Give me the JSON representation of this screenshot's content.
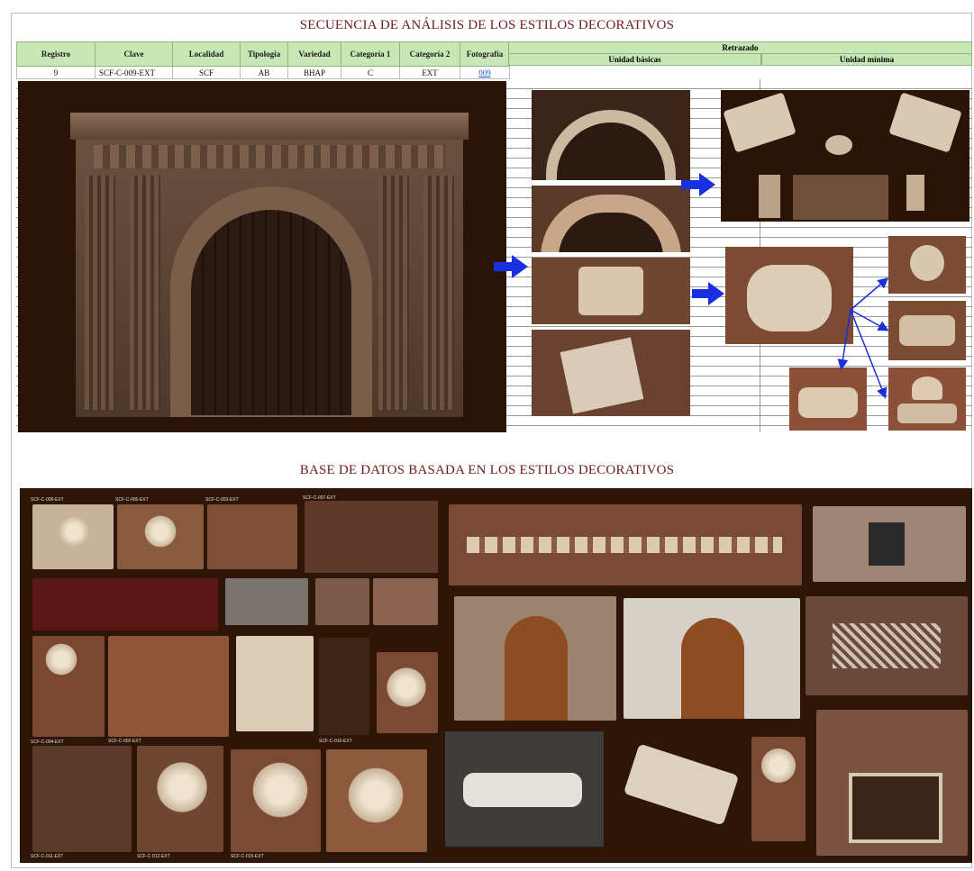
{
  "title_top": "SECUENCIA DE ANÁLISIS DE LOS ESTILOS DECORATIVOS",
  "title_bottom": "BASE DE DATOS BASADA EN LOS ESTILOS DECORATIVOS",
  "table": {
    "headers": [
      "Registro",
      "Clave",
      "Localidad",
      "Tipología",
      "Variedad",
      "Categoría 1",
      "Categoría 2",
      "Fotografía"
    ],
    "row": [
      "9",
      "SCF-C-009-EXT",
      "SCF",
      "AB",
      "BHAP",
      "C",
      "EXT",
      "009"
    ]
  },
  "retrazado": {
    "title": "Retrazado",
    "col1": "Unidad básicas",
    "col2": "Unidad mínima"
  },
  "colors": {
    "title": "#6b1d1d",
    "header_green": "#c7e8b6",
    "arrow_blue": "#1a2fe0",
    "photo_bg": "#2a1408"
  },
  "db_labels": [
    "SCF-C-009-EXT",
    "SCF-C-005-EXT",
    "SCF-C-003-EXT",
    "SCF-C-007-EXT",
    "SCF-C-004-EXT",
    "SCF-C-002-EXT",
    "SCF-C-010-EXT",
    "SCF-C-011-EXT",
    "SCF-C-012-EXT",
    "SCF-C-015-EXT"
  ]
}
